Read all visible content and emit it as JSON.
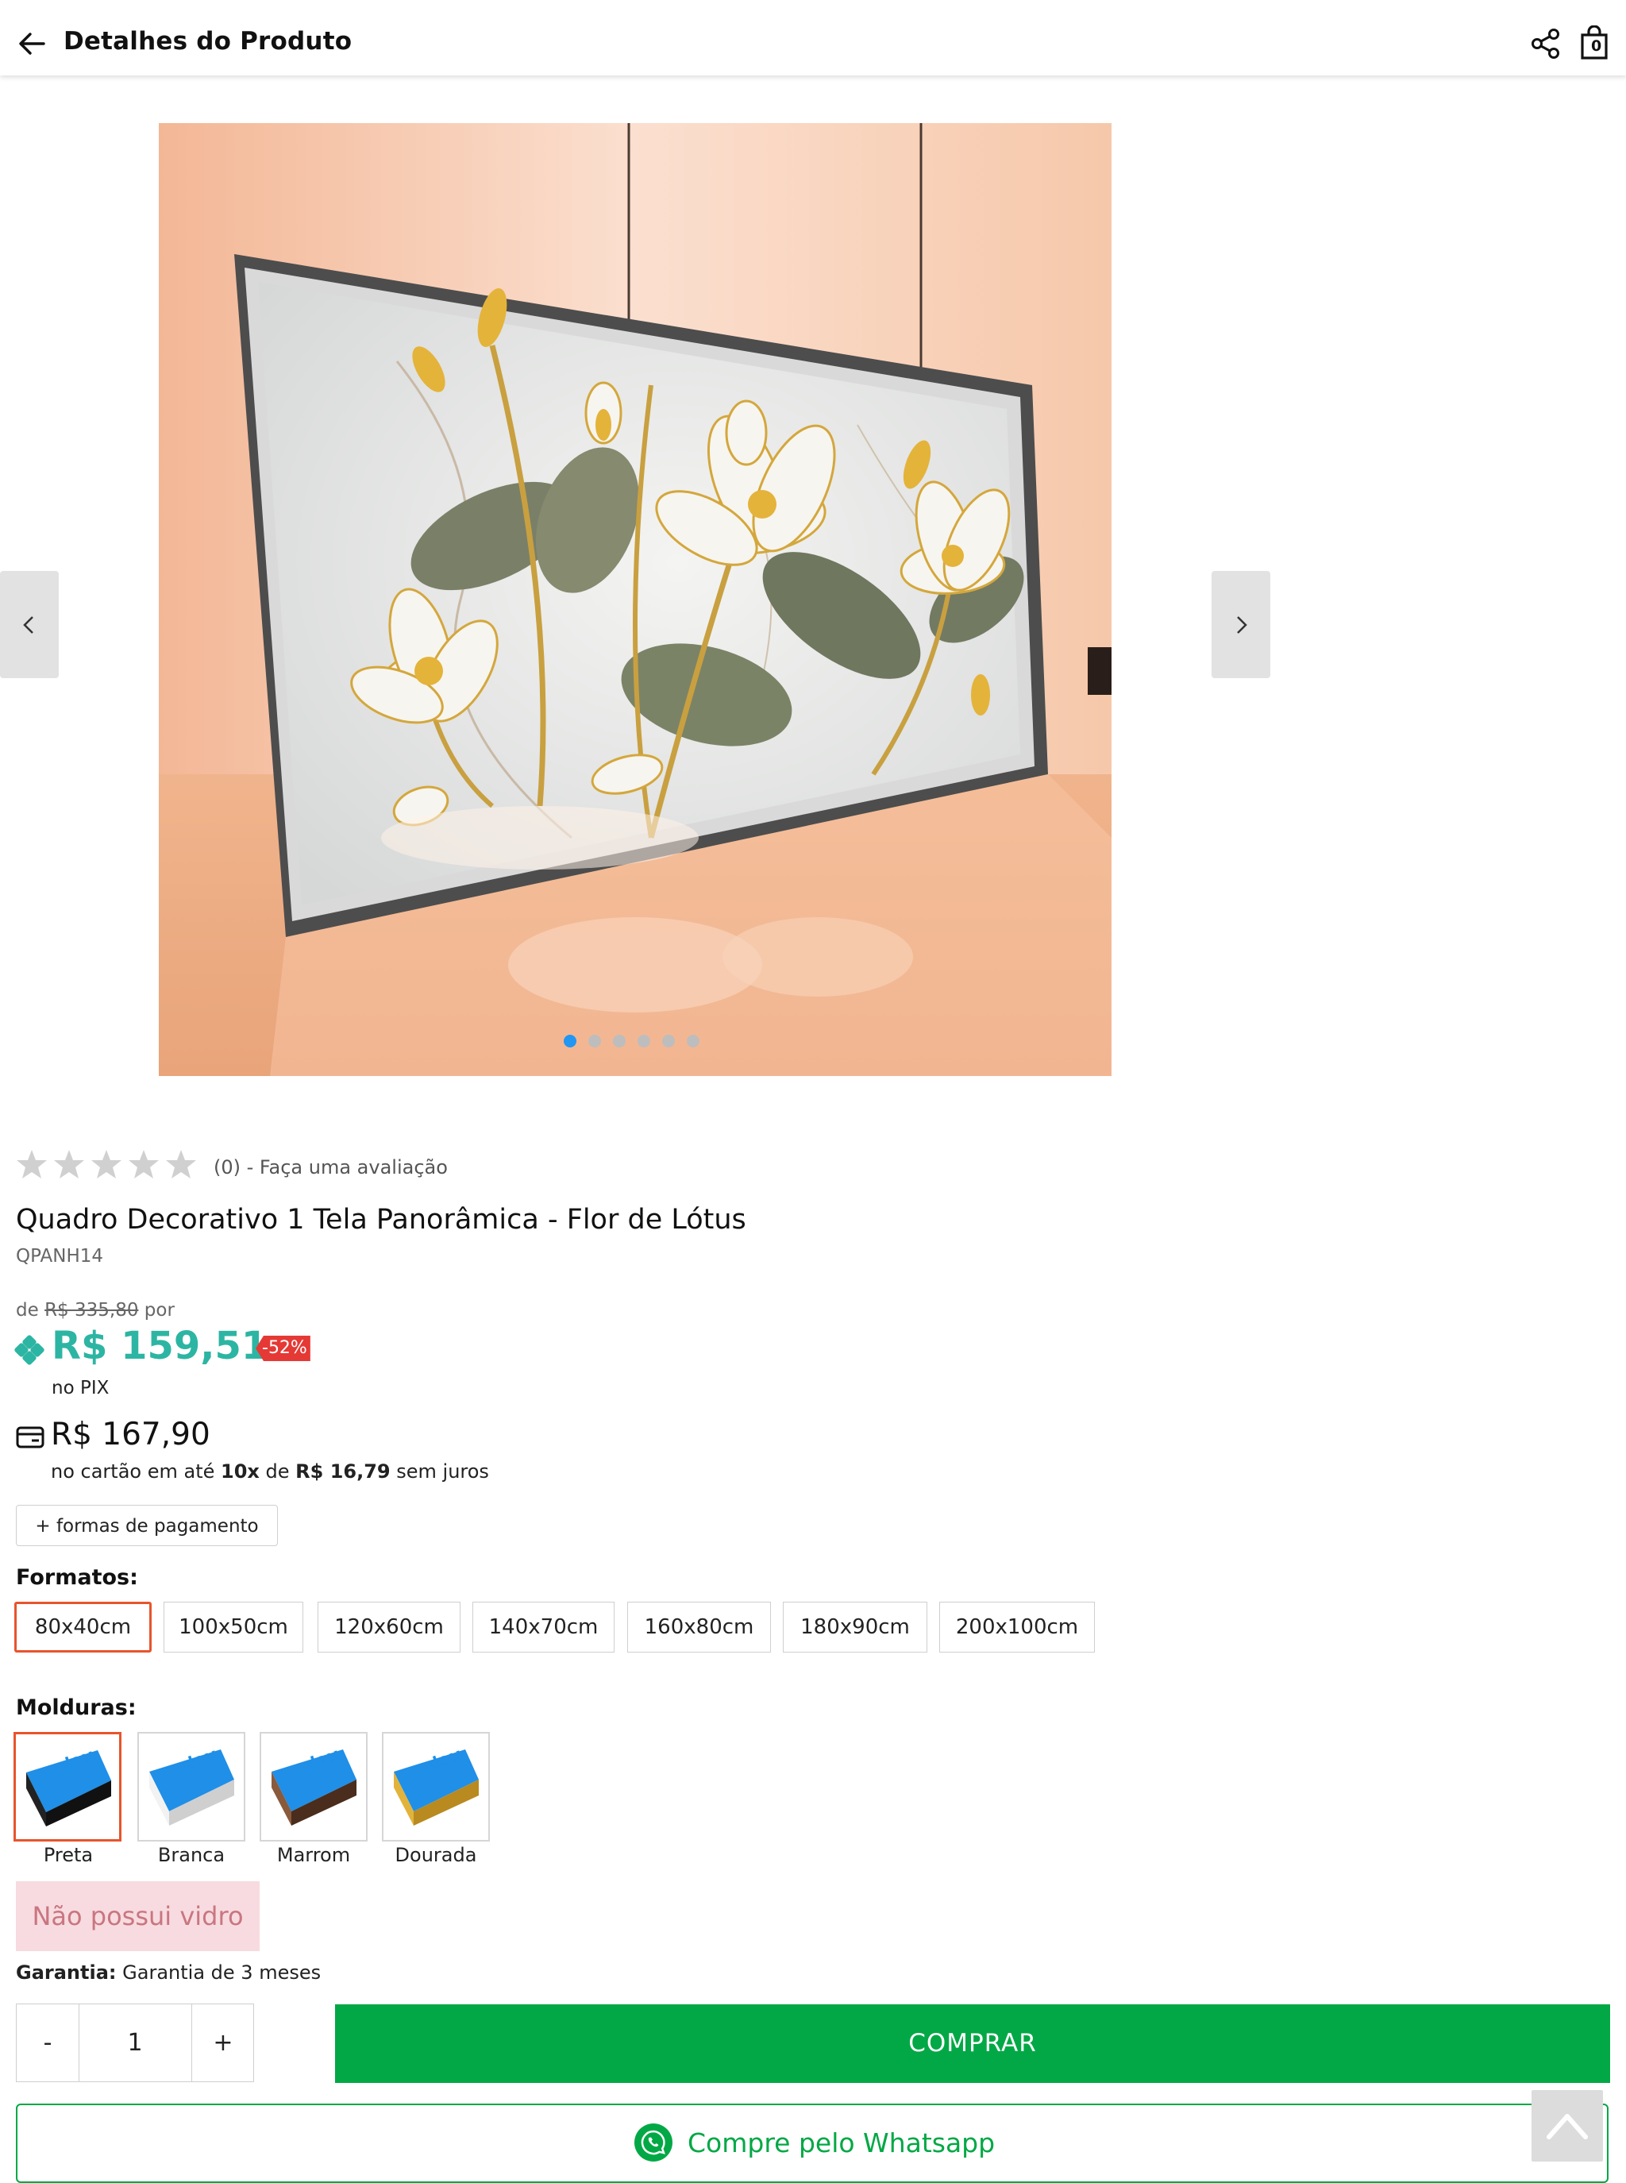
{
  "header": {
    "title": "Detalhes do Produto",
    "cart_count": "0"
  },
  "gallery": {
    "slides": 6,
    "active_slide": 1
  },
  "rating": {
    "stars": 0,
    "text": "(0) - Faça uma avaliação"
  },
  "product": {
    "title": "Quadro Decorativo 1 Tela Panorâmica - Flor de Lótus",
    "sku": "QPANH14"
  },
  "price": {
    "prefix": "de",
    "old": "R$ 335,80",
    "suffix": "por",
    "pix_price": "R$ 159,51",
    "discount": "-52%",
    "pix_label": "no PIX",
    "card_price": "R$ 167,90",
    "installment_pre": "no cartão em até ",
    "installment_count": "10x",
    "installment_mid": " de ",
    "installment_value": "R$ 16,79",
    "installment_post": " sem juros",
    "payment_button": "+ formas de pagamento"
  },
  "formats": {
    "label": "Formatos:",
    "options": [
      "80x40cm",
      "100x50cm",
      "120x60cm",
      "140x70cm",
      "160x80cm",
      "180x90cm",
      "200x100cm"
    ],
    "selected": "80x40cm"
  },
  "frames": {
    "label": "Molduras:",
    "options": [
      "Preta",
      "Branca",
      "Marrom",
      "Dourada"
    ],
    "selected": "Preta"
  },
  "glass": "Não possui vidro",
  "warranty": {
    "label": "Garantia:",
    "value": "Garantia de 3 meses"
  },
  "quantity": {
    "minus": "-",
    "value": "1",
    "plus": "+"
  },
  "actions": {
    "buy": "COMPRAR",
    "whatsapp": "Compre pelo Whatsapp"
  },
  "colors": {
    "pix": "#2db5a3",
    "buy": "#02a845",
    "selected_border": "#e8542c",
    "discount": "#e53935"
  }
}
